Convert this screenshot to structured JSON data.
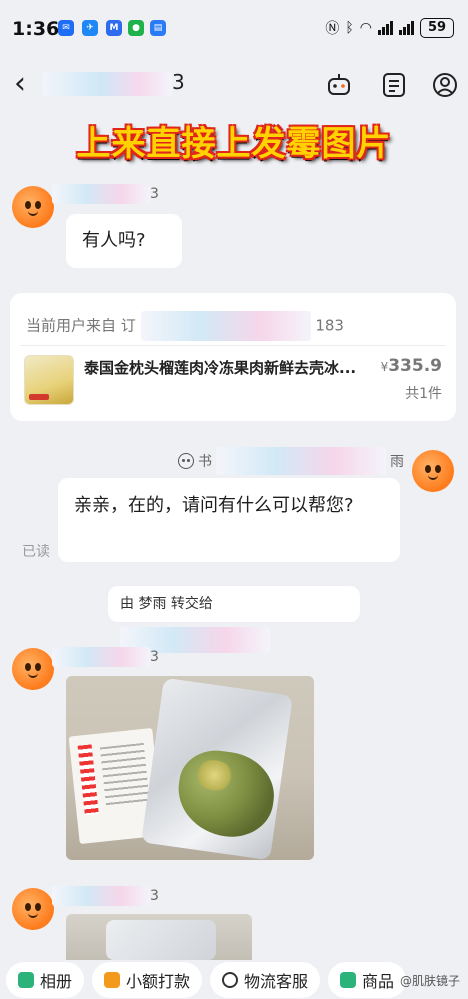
{
  "status_bar": {
    "time": "1:36",
    "battery": "59",
    "notif_icons": [
      {
        "name": "mail-app-icon",
        "color": "#1e6df5",
        "glyph": "✉"
      },
      {
        "name": "feishu-app-icon",
        "color": "#1e88f5",
        "glyph": "✈"
      },
      {
        "name": "m-app-icon",
        "color": "#2d6cf0",
        "glyph": "M"
      },
      {
        "name": "wechat-app-icon",
        "color": "#1fb24a",
        "glyph": "●"
      },
      {
        "name": "doc-app-icon",
        "color": "#2a7cf6",
        "glyph": "▤"
      }
    ]
  },
  "nav": {
    "title_suffix": "3"
  },
  "banner": {
    "text": "上来直接上发霉图片"
  },
  "messages": {
    "customer_name_suffix": "3",
    "customer_text": "有人吗?",
    "order_card": {
      "head_prefix": "当前用户来自 订",
      "head_suffix": "183",
      "product_name": "泰国金枕头榴莲肉冷冻果肉新鲜去壳冰...",
      "price_symbol": "¥",
      "price": "335.9",
      "quantity": "共1件"
    },
    "agent_name_prefix": "书",
    "agent_name_suffix": "雨",
    "agent_text": "亲亲，在的，请问有什么可以帮您?",
    "read_label": "已读",
    "transfer_text": "由 梦雨 转交给",
    "customer_name_suffix_2": "3",
    "customer_name_suffix_3": "3"
  },
  "bottom_bar": {
    "buttons": [
      {
        "name": "album-button",
        "label": "相册",
        "icon_color": "#2bb37a"
      },
      {
        "name": "small-payment-button",
        "label": "小额打款",
        "icon_color": "#f39a1c"
      },
      {
        "name": "logistics-service-button",
        "label": "物流客服",
        "icon_color": "#333333"
      },
      {
        "name": "more-tools-button",
        "label": "商品",
        "icon_color": "#2bb37a"
      }
    ],
    "watermark": "@肌肤镜子"
  }
}
